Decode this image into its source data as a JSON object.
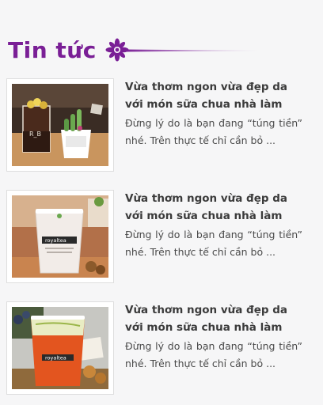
{
  "section": {
    "title": "Tin tức"
  },
  "colors": {
    "accent": "#7a1f96",
    "title_text": "#3b3b3b",
    "body_text": "#4a4a4a",
    "background": "#f6f6f7"
  },
  "icons": {
    "header_decoration": "flower-icon"
  },
  "news": [
    {
      "title": "Vừa thơm ngon vừa đẹp da với món sữa chua nhà làm",
      "excerpt": "Đừng lý do là bạn đang “túng tiền” nhé. Trên thực tế chỉ cần bỏ ...",
      "image": "milk-tea-cactus-cups"
    },
    {
      "title": "Vừa thơm ngon vừa đẹp da với món sữa chua nhà làm",
      "excerpt": "Đừng lý do là bạn đang “túng tiền” nhé. Trên thực tế chỉ cần bỏ ...",
      "image": "royaltea-milk-cup"
    },
    {
      "title": "Vừa thơm ngon vừa đẹp da với món sữa chua nhà làm",
      "excerpt": "Đừng lý do là bạn đang “túng tiền” nhé. Trên thực tế chỉ cần bỏ ...",
      "image": "royaltea-orange-matcha-cup"
    }
  ]
}
